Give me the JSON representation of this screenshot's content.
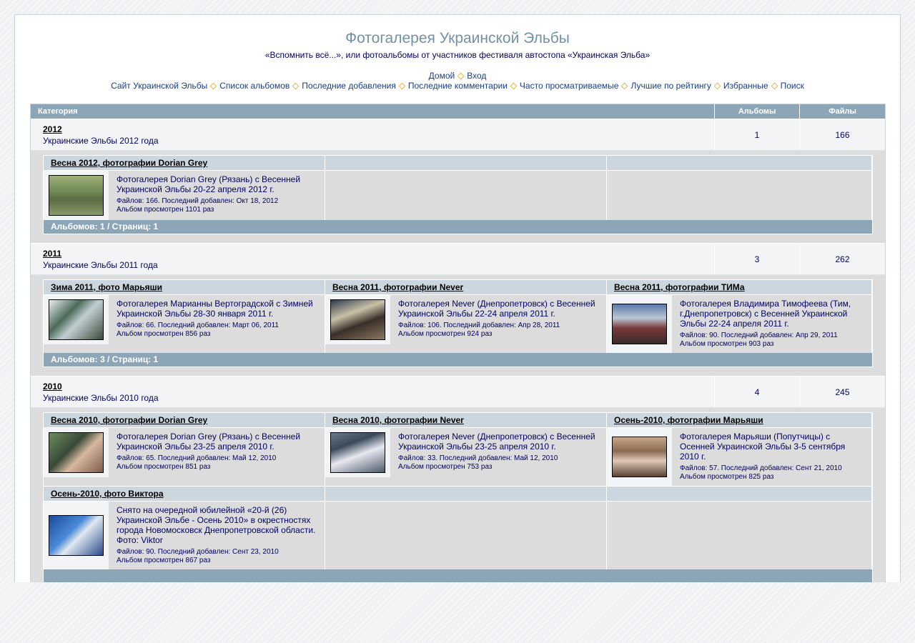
{
  "site": {
    "title": "Фотогалерея Украинской Эльбы",
    "description": "«Вспомнить всё...», или фотоальбомы от участников фестиваля автостопа «Украинская Эльба»"
  },
  "nav": {
    "home": "Домой",
    "login": "Вход",
    "links": [
      "Сайт Украинской Эльбы",
      "Список альбомов",
      "Последние добавления",
      "Последние комментарии",
      "Часто просматриваемые",
      "Лучшие по рейтингу",
      "Избранные",
      "Поиск"
    ]
  },
  "table": {
    "col_category": "Категория",
    "col_albums": "Альбомы",
    "col_files": "Файлы"
  },
  "categories": [
    {
      "name": "2012",
      "desc": "Украинские Эльбы 2012 года",
      "albums": "1",
      "files": "166",
      "footer": "Альбомов: 1 / Страниц: 1",
      "items": [
        {
          "title": "Весна 2012, фотографии Dorian Grey",
          "desc": "Фотогалерея Dorian Grey (Рязань) с Весенней Украинской Эльбы 20-22 апреля 2012 г.",
          "meta1": "Файлов: 166. Последний добавлен: Окт 18, 2012",
          "meta2": "Альбом просмотрен 1101 раз"
        }
      ]
    },
    {
      "name": "2011",
      "desc": "Украинские Эльбы 2011 года",
      "albums": "3",
      "files": "262",
      "footer": "Альбомов: 3 / Страниц: 1",
      "items": [
        {
          "title": "Зима 2011, фото Марьяши",
          "desc": "Фотогалерея Марианны Вертоградской с Зимней Украинской Эльбы 28-30 января 2011 г.",
          "meta1": "Файлов: 66. Последний добавлен: Март 06, 2011",
          "meta2": "Альбом просмотрен 856 раз"
        },
        {
          "title": "Весна 2011, фотографии Never",
          "desc": "Фотогалерея Never (Днепропетровск) с Весенней Украинской Эльбы 22-24 апреля 2011 г.",
          "meta1": "Файлов: 106. Последний добавлен: Апр 28, 2011",
          "meta2": "Альбом просмотрен 924 раз"
        },
        {
          "title": "Весна 2011, фотографии ТИМа",
          "desc": "Фотогалерея Владимира Тимофеева (Тим, г.Днепропетровск) с Весенней Украинской Эльбы 22-24 апреля 2011 г.",
          "meta1": "Файлов: 90. Последний добавлен: Апр 29, 2011",
          "meta2": "Альбом просмотрен 903 раз"
        }
      ]
    },
    {
      "name": "2010",
      "desc": "Украинские Эльбы 2010 года",
      "albums": "4",
      "files": "245",
      "items": [
        {
          "title": "Весна 2010, фотографии Dorian Grey",
          "desc": "Фотогалерея Dorian Grey (Рязань) с Весенней Украинской Эльбы 23-25 апреля 2010 г.",
          "meta1": "Файлов: 65. Последний добавлен: Май 12, 2010",
          "meta2": "Альбом просмотрен 851 раз"
        },
        {
          "title": "Весна 2010, фотографии Never",
          "desc": "Фотогалерея Never (Днепропетровск) с Весенней Украинской Эльбы 23-25 апреля 2010 г.",
          "meta1": "Файлов: 33. Последний добавлен: Май 12, 2010",
          "meta2": "Альбом просмотрен 753 раз"
        },
        {
          "title": "Осень-2010, фотографии Марьяши",
          "desc": "Фотогалерея Марьяши (Попутчицы) с Осенней Украинской Эльбы 3-5 сентября 2010 г.",
          "meta1": "Файлов: 57. Последний добавлен: Сент 21, 2010",
          "meta2": "Альбом просмотрен 825 раз"
        },
        {
          "title": "Осень-2010, фото Виктора",
          "desc": "Снято на очередной юбилейной «20-й (26) Украинской Эльбе - Осень 2010» в окрестностях города Новомосковск Днепропетровской области. Фото: Viktor",
          "meta1": "Файлов: 90. Последний добавлен: Сент 23, 2010",
          "meta2": "Альбом просмотрен 867 раз"
        }
      ]
    }
  ]
}
